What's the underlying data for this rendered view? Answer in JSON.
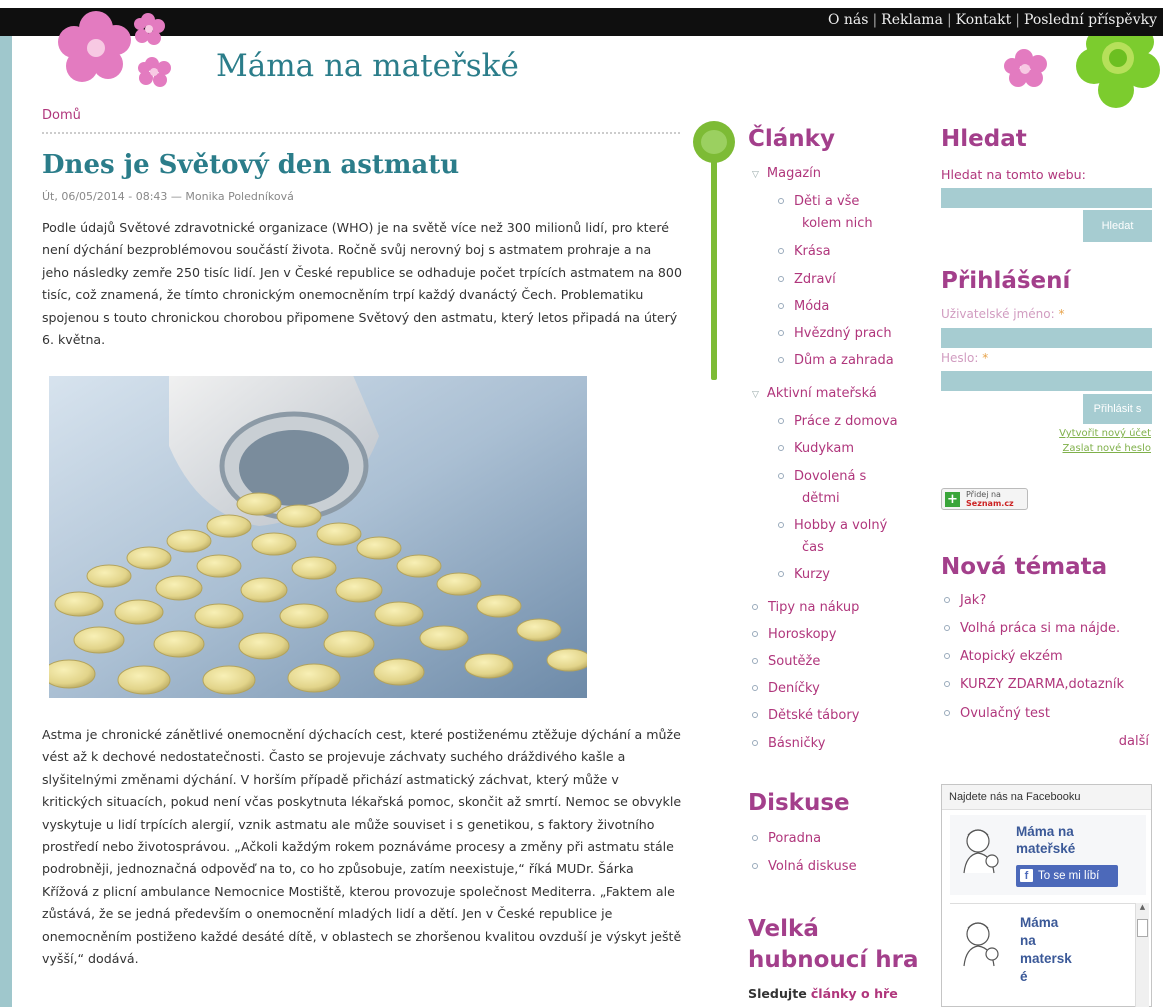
{
  "nav": [
    "O nás",
    "Reklama",
    "Kontakt",
    "Poslední příspěvky"
  ],
  "site_title": "Máma na mateřské",
  "breadcrumb": "Domů",
  "article": {
    "title": "Dnes je Světový den astmatu",
    "meta": "Út, 06/05/2014 - 08:43 — Monika Poledníková",
    "para1": "Podle údajů Světové zdravotnické organizace (WHO) je na světě více než 300 milionů lidí, pro které není dýchání bezproblémovou součástí života. Ročně svůj nerovný boj s astmatem prohraje a na jeho následky zemře 250 tisíc lidí. Jen v České republice se odhaduje počet trpících astmatem na 800 tisíc, což znamená, že tímto chronickým onemocněním trpí každý dvanáctý Čech. Problematiku spojenou s touto chronickou chorobou připomene Světový den astmatu, který letos připadá na úterý 6. května.",
    "para2": "Astma je chronické zánětlivé onemocnění dýchacích cest, které postiženému ztěžuje dýchání a může vést až k dechové nedostatečnosti. Často se projevuje záchvaty suchého dráždivého kašle a slyšitelnými změnami dýchání. V horším případě přichází astmatický záchvat, který může v kritických situacích, pokud není včas poskytnuta lékařská pomoc, skončit až smrtí. Nemoc se obvykle vyskytuje u lidí trpících alergií, vznik astmatu ale může souviset i s genetikou, s faktory životního prostředí nebo životosprávou. „Ačkoli každým rokem poznáváme procesy a změny při astmatu stále podrobněji, jednoznačná odpověď na to, co ho způsobuje, zatím neexistuje,“ říká MUDr. Šárka Křížová z plicní ambulance Nemocnice Mostiště, kterou provozuje společnost Mediterra. „Faktem ale zůstává, že se jedná především o onemocnění mladých lidí a dětí. Jen v České republice je onemocněním postiženo každé desáté dítě, v oblastech se zhoršenou kvalitou ovzduší je výskyt ještě vyšší,“ dodává."
  },
  "clanky": {
    "heading": "Články",
    "magazin": "Magazín",
    "magazin_items": [
      "Děti a vše",
      "kolem nich",
      "Krása",
      "Zdraví",
      "Móda",
      "Hvězdný prach",
      "Dům a zahrada"
    ],
    "aktivni": "Aktivní mateřská",
    "aktivni_items": [
      "Práce z domova",
      "Kudykam",
      "Dovolená s",
      "dětmi",
      "Hobby a volný",
      "čas",
      "Kurzy"
    ],
    "top_items": [
      "Tipy na nákup",
      "Horoskopy",
      "Soutěže",
      "Deníčky",
      "Dětské tábory",
      "Básničky"
    ]
  },
  "diskuse": {
    "heading": "Diskuse",
    "items": [
      "Poradna",
      "Volná diskuse"
    ]
  },
  "hra": {
    "heading1": "Velká",
    "heading2": "hubnoucí hra",
    "text_prefix": "Sledujte",
    "text_link": "články o hře"
  },
  "search": {
    "heading": "Hledat",
    "label": "Hledat na tomto webu:",
    "button": "Hledat"
  },
  "login": {
    "heading": "Přihlášení",
    "user_label": "Uživatelské jméno:",
    "pass_label": "Heslo:",
    "required_mark": "*",
    "button": "Přihlásit s",
    "create": "Vytvořit nový účet",
    "reset": "Zaslat nové heslo"
  },
  "seznam_badge": {
    "line1": "Přidej na",
    "line2": "Seznam.cz"
  },
  "nova_temata": {
    "heading": "Nová témata",
    "items": [
      "Jak?",
      "Volhá práca si ma nájde.",
      "Atopický ekzém",
      "KURZY ZDARMA,dotazník",
      "Ovulačný test"
    ],
    "more": "další"
  },
  "facebook": {
    "header": "Najdete nás na Facebooku",
    "page1": [
      "Máma na",
      "mateřské"
    ],
    "like": "To se mi líbí",
    "page2": [
      "Máma",
      "na",
      "matersk",
      "é"
    ]
  },
  "colors": {
    "teal": "#2b7d8a",
    "magenta": "#b0367c",
    "heading_purple": "#a33f8b",
    "field_blue": "#a6ccd1",
    "green": "#7dbb35"
  }
}
